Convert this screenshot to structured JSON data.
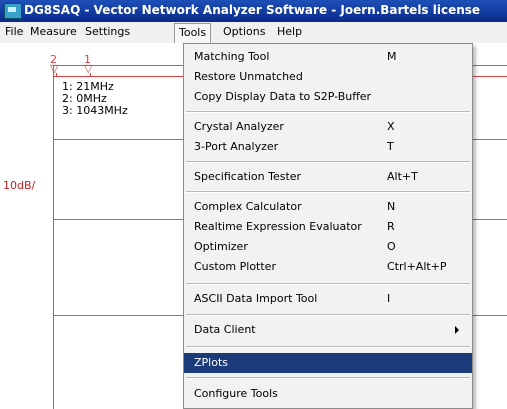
{
  "window": {
    "title": "DG8SAQ - Vector Network Analyzer Software - Joern.Bartels license"
  },
  "menubar": {
    "items": [
      "File",
      "Measure",
      "Settings",
      "Tools",
      "Options",
      "Help"
    ]
  },
  "plot": {
    "markers": [
      "2",
      "1"
    ],
    "legend": [
      "1:   21MHz",
      "2:    0MHz",
      "3:  1043MHz"
    ],
    "scale_label": "10dB/"
  },
  "tools_menu": {
    "items": [
      {
        "label": "Matching Tool",
        "shortcut": "M"
      },
      {
        "label": "Restore Unmatched",
        "shortcut": ""
      },
      {
        "label": "Copy Display Data to S2P-Buffer",
        "shortcut": ""
      },
      {
        "label": "Crystal Analyzer",
        "shortcut": "X"
      },
      {
        "label": "3-Port Analyzer",
        "shortcut": "T"
      },
      {
        "label": "Specification Tester",
        "shortcut": "Alt+T"
      },
      {
        "label": "Complex Calculator",
        "shortcut": "N"
      },
      {
        "label": "Realtime Expression Evaluator",
        "shortcut": "R"
      },
      {
        "label": "Optimizer",
        "shortcut": "O"
      },
      {
        "label": "Custom Plotter",
        "shortcut": "Ctrl+Alt+P"
      },
      {
        "label": "ASCII Data Import Tool",
        "shortcut": "I"
      },
      {
        "label": "Data Client",
        "shortcut": ""
      },
      {
        "label": "ZPlots",
        "shortcut": ""
      },
      {
        "label": "Configure Tools",
        "shortcut": ""
      }
    ],
    "highlighted": "ZPlots"
  },
  "colors": {
    "titlebar": "#0a2a8a",
    "highlight": "#1a3a7a",
    "trace": "#e04040"
  }
}
